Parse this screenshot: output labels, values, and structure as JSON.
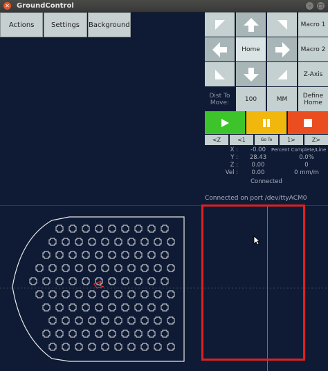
{
  "window": {
    "title": "GroundControl"
  },
  "menubar": {
    "actions": "Actions",
    "settings": "Settings",
    "background": "Background"
  },
  "jog": {
    "home": "Home",
    "macro1": "Macro 1",
    "macro2": "Macro 2",
    "zaxis": "Z-Axis",
    "dist_label": "Dist To Move:",
    "dist_value": "100",
    "units": "MM",
    "define_home": "Define Home"
  },
  "steps": {
    "z_minus": "<Z",
    "minus1": "<1",
    "goto": "Go To",
    "plus1": "1>",
    "z_plus": "Z>"
  },
  "readout": {
    "x_label": "X :",
    "x_value": "-0.00",
    "y_label": "Y :",
    "y_value": "28.43",
    "z_label": "Z :",
    "z_value": "0.00",
    "vel_label": "Vel :",
    "vel_value": "0.00",
    "pct_header": "Percent Complete/Line",
    "pct_value": "0.0%",
    "line_value": "0",
    "feed_value": "0 mm/m"
  },
  "status": {
    "connected": "Connected",
    "port_message": "Connected on port /dev/ttyACM0"
  },
  "colors": {
    "background": "#0f1b35",
    "play": "#3dc42a",
    "pause": "#f2b70c",
    "stop": "#ea4d1f",
    "selection": "#e02020"
  }
}
